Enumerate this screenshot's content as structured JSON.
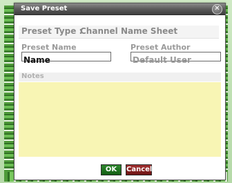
{
  "dialog": {
    "title": "Save Preset",
    "close_glyph": "✕",
    "close_icon": "close-icon"
  },
  "preset_type": {
    "label": "Preset Type :",
    "value": "Channel Name Sheet"
  },
  "preset_name": {
    "label": "Preset Name",
    "value": "Name"
  },
  "preset_author": {
    "label": "Preset Author",
    "value": "Default User"
  },
  "notes": {
    "label": "Notes",
    "value": ""
  },
  "buttons": {
    "ok_label": "OK",
    "cancel_label": "Cancel"
  },
  "colors": {
    "notes_background": "#f8f5b4",
    "ok_button": "#1f731f",
    "cancel_button": "#8a1f1f",
    "titlebar": "#4a4a4a"
  }
}
